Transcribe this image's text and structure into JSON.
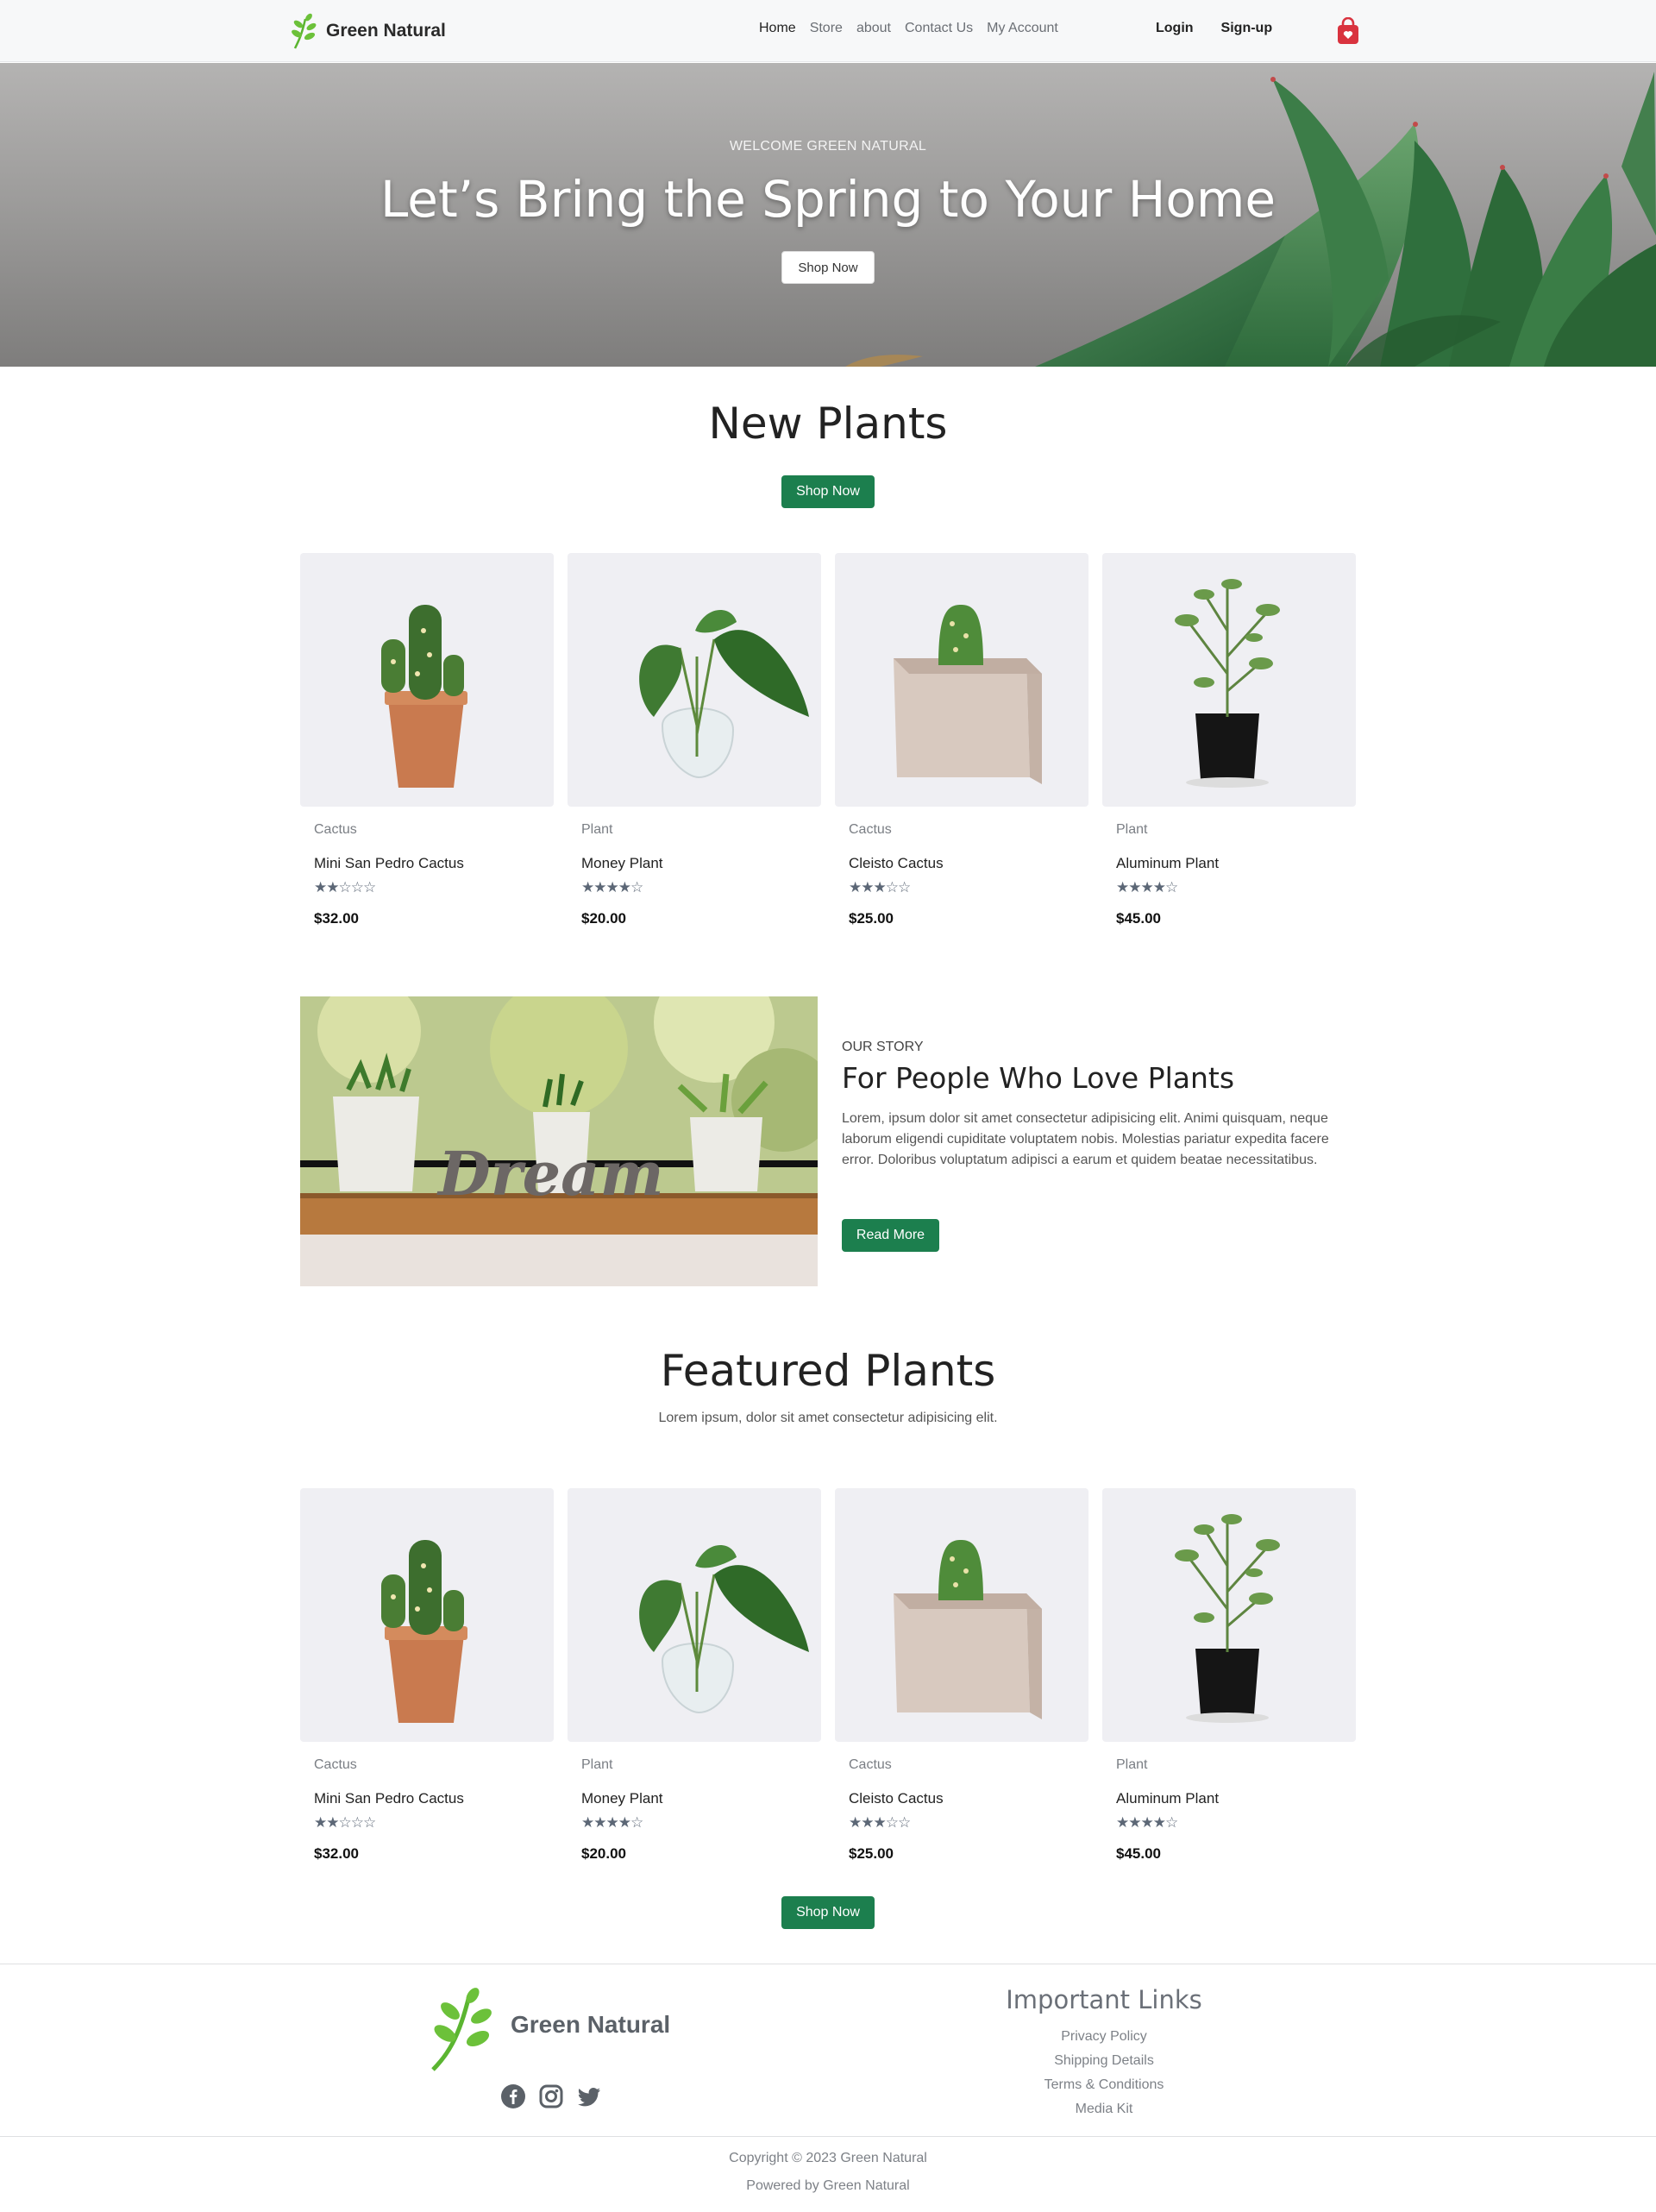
{
  "nav": {
    "brand": "Green Natural",
    "links": [
      "Home",
      "Store",
      "about",
      "Contact Us",
      "My Account"
    ],
    "login": "Login",
    "signup": "Sign-up"
  },
  "hero": {
    "subtitle": "WELCOME GREEN NATURAL",
    "title": "Let’s Bring the Spring to Your Home",
    "button": "Shop Now"
  },
  "new_plants": {
    "title": "New Plants",
    "button": "Shop Now",
    "products": [
      {
        "category": "Cactus",
        "name": "Mini San Pedro Cactus",
        "rating": 2,
        "price": "$32.00"
      },
      {
        "category": "Plant",
        "name": "Money Plant",
        "rating": 4,
        "price": "$20.00"
      },
      {
        "category": "Cactus",
        "name": "Cleisto Cactus",
        "rating": 3,
        "price": "$25.00"
      },
      {
        "category": "Plant",
        "name": "Aluminum Plant",
        "rating": 4,
        "price": "$45.00"
      }
    ]
  },
  "story": {
    "eyebrow": "OUR STORY",
    "title": "For People Who Love Plants",
    "text": "Lorem, ipsum dolor sit amet consectetur adipisicing elit. Animi quisquam, neque laborum eligendi cupiditate voluptatem nobis. Molestias pariatur expedita facere error. Doloribus voluptatum adipisci a earum et quidem beatae necessitatibus.",
    "button": "Read More",
    "image_text": "Dream"
  },
  "featured": {
    "title": "Featured Plants",
    "description": "Lorem ipsum, dolor sit amet consectetur adipisicing elit.",
    "button": "Shop Now",
    "products": [
      {
        "category": "Cactus",
        "name": "Mini San Pedro Cactus",
        "rating": 2,
        "price": "$32.00"
      },
      {
        "category": "Plant",
        "name": "Money Plant",
        "rating": 4,
        "price": "$20.00"
      },
      {
        "category": "Cactus",
        "name": "Cleisto Cactus",
        "rating": 3,
        "price": "$25.00"
      },
      {
        "category": "Plant",
        "name": "Aluminum Plant",
        "rating": 4,
        "price": "$45.00"
      }
    ]
  },
  "footer": {
    "brand": "Green Natural",
    "links_title": "Important Links",
    "links": [
      "Privacy Policy",
      "Shipping Details",
      "Terms & Conditions",
      "Media Kit"
    ],
    "socials": [
      "facebook-icon",
      "instagram-icon",
      "twitter-icon"
    ],
    "copyright": "Copyright © 2023 Green Natural",
    "powered": "Powered by Green Natural"
  },
  "colors": {
    "accent_green": "#1c7f4e",
    "cart_red": "#d9333f",
    "card_bg": "#efeff3"
  }
}
